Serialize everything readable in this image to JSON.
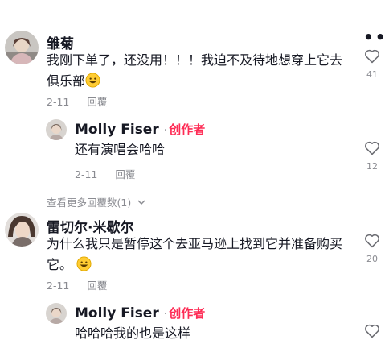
{
  "more_icon": "more-horizontal-icon",
  "comments": [
    {
      "author": "雏菊",
      "text_line1": "我刚下单了，还没用！！！我迫不及待地想穿上它去",
      "text_line2": "俱乐部",
      "date": "2-11",
      "reply_label": "回覆",
      "likes": "41"
    },
    {
      "author": "Molly Fiser",
      "badge": "创作者",
      "text": "还有演唱会哈哈",
      "date": "2-11",
      "reply_label": "回覆",
      "likes": "12"
    },
    {
      "author": "雷切尔·米歇尔",
      "text_line1": "为什么我只是暂停这个去亚马逊上找到它并准备购买",
      "text_line2": "它。",
      "date": "2-11",
      "reply_label": "回覆",
      "likes": "20"
    },
    {
      "author": "Molly Fiser",
      "badge": "创作者",
      "text": "哈哈哈我的也是这样",
      "likes": ""
    }
  ],
  "view_more_replies": "查看更多回覆数(1)",
  "colors": {
    "accent": "#fe2c55",
    "muted": "#8a8b91",
    "text": "#161823"
  }
}
